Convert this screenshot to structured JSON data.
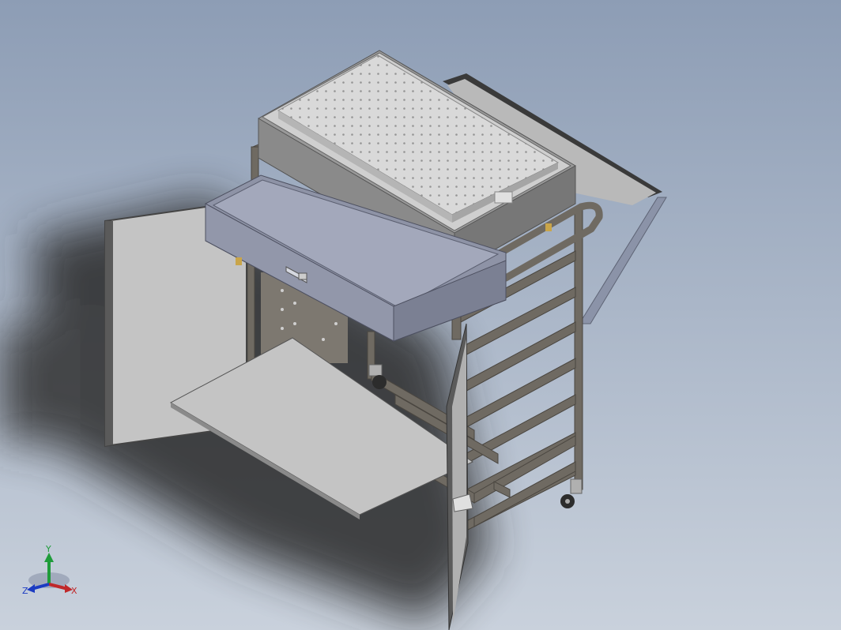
{
  "viewport": {
    "background_top": "#8d9db5",
    "background_bottom": "#c9d1dc"
  },
  "model": {
    "frame_color": "#6f6a62",
    "panel_color": "#c8c8c8",
    "drawer_color": "#8e93a6",
    "tray_color": "#a9a9a9"
  },
  "triad": {
    "y_label": "Y",
    "x_label": "X",
    "z_label": "Z",
    "y_color": "#1f9c3a",
    "x_color": "#c0282a",
    "z_color": "#1c3bc2"
  }
}
